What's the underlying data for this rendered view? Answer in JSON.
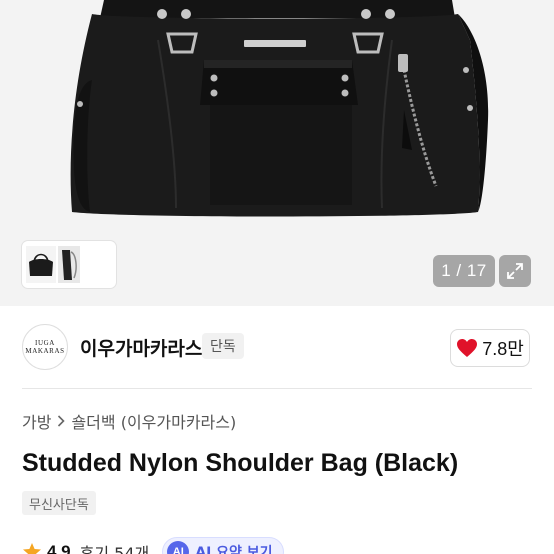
{
  "gallery": {
    "counter_text": "1 / 17"
  },
  "brand": {
    "logo_line1": "IUGA",
    "logo_line2": "MAKARAS",
    "name": "이우가마카라스",
    "badge": "단독",
    "like_count": "7.8만"
  },
  "product": {
    "breadcrumb": [
      "가방",
      "숄더백 (이우가마카라스)"
    ],
    "title": "Studded Nylon Shoulder Bag (Black)",
    "exclusive_badge": "무신사단독",
    "rating": "4.9",
    "reviews": "후기 54개",
    "ai_summary_label": "AI 요약 보기",
    "ai_chip_text": "AI"
  },
  "colors": {
    "heart": "#e0122a",
    "star": "#f5a623",
    "ai_accent": "#5667ea"
  },
  "icons": [
    "chevron-right-icon",
    "expand-icon",
    "heart-icon",
    "star-icon",
    "ai-icon"
  ]
}
